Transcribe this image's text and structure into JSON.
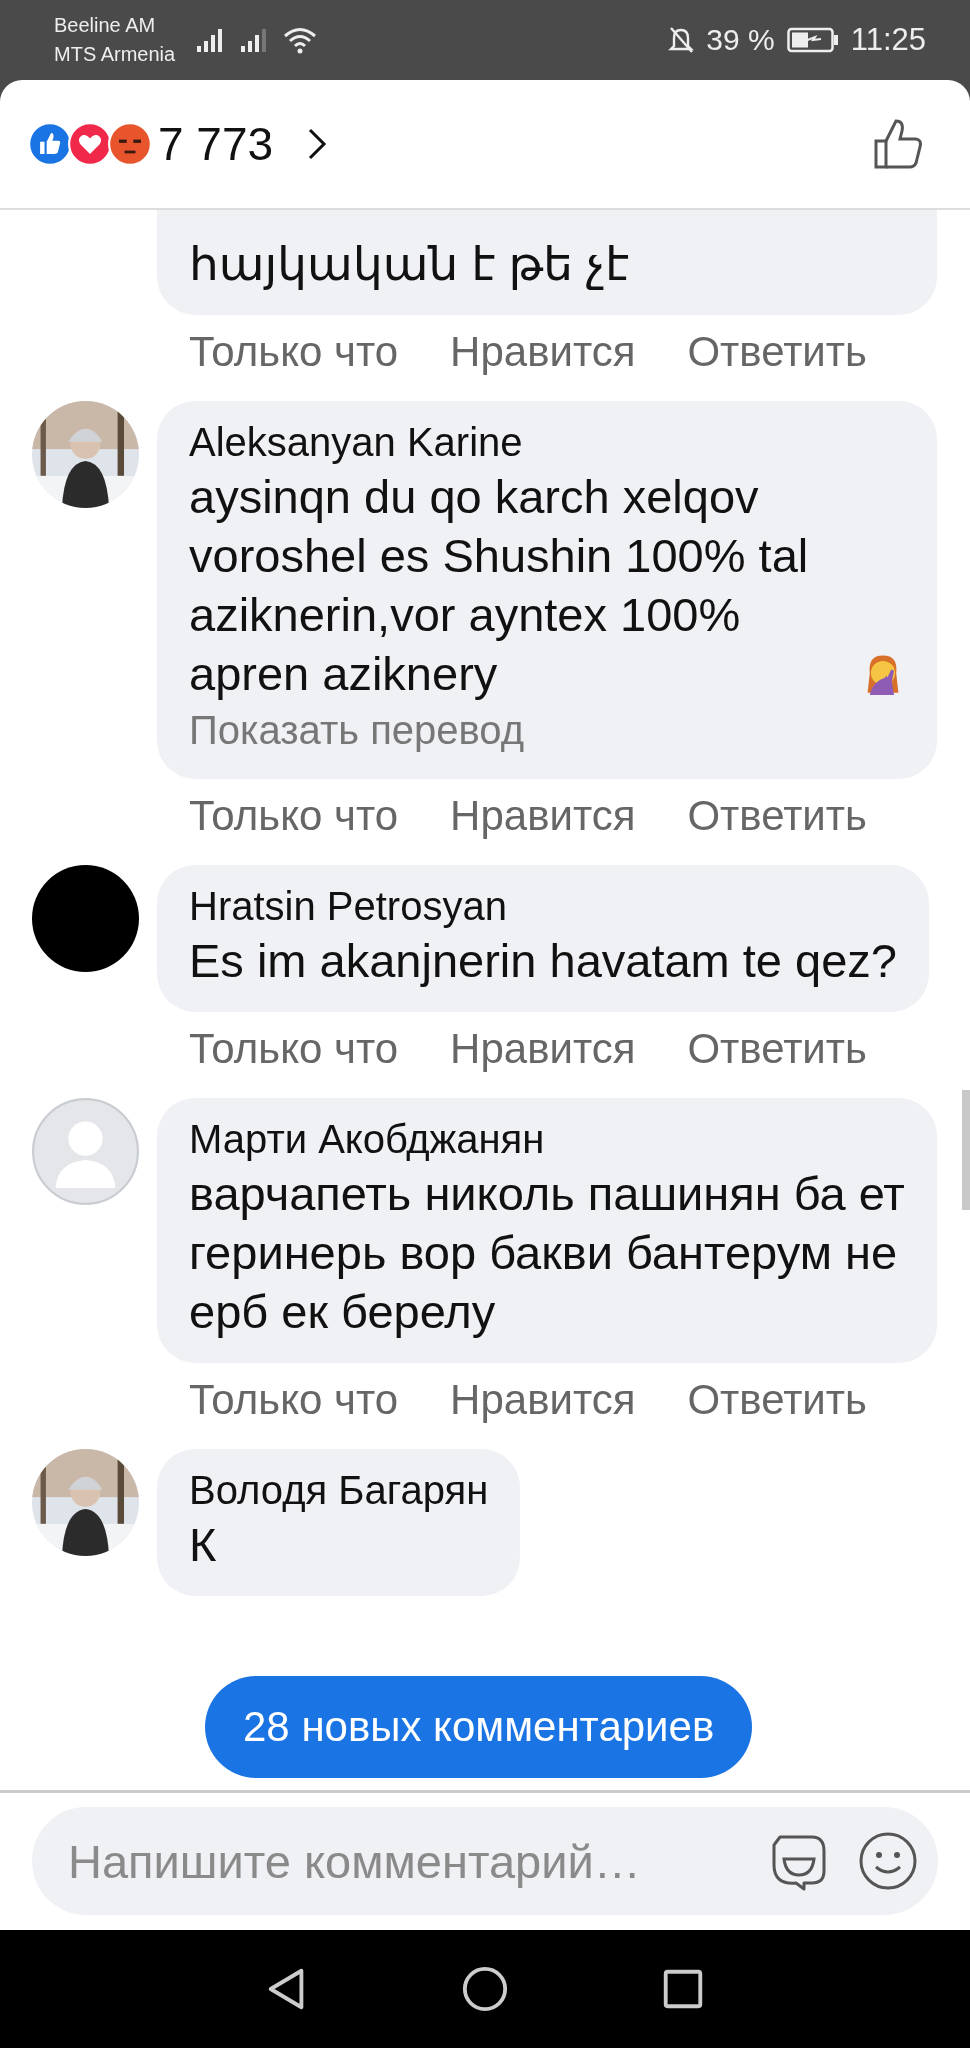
{
  "status_bar": {
    "carriers": [
      "Beeline AM",
      "MTS Armenia"
    ],
    "battery": "39 %",
    "time": "11:25"
  },
  "reactions": {
    "count": "7 773"
  },
  "comments": [
    {
      "avatar": {
        "kind": "none"
      },
      "text": "հայկական է թե չէ",
      "actions": [
        "Только что",
        "Нравится",
        "Ответить"
      ]
    },
    {
      "author": "Aleksanyan Karine",
      "text": "aysinqn du qo karch xelqov voroshel es Shushin 100% tal aziknerin,vor ayntex 100% apren aziknery",
      "trailing_emoji": true,
      "translate": "Показать перевод",
      "actions": [
        "Только что",
        "Нравится",
        "Ответить"
      ]
    },
    {
      "author": "Hratsin Petrosyan",
      "text": "Es im akanjnerin havatam te qez?",
      "actions": [
        "Только что",
        "Нравится",
        "Ответить"
      ]
    },
    {
      "avatar": {
        "kind": "default"
      },
      "author": "Марти Акобджанян",
      "text": "варчапеть николь пашинян ба ет геринерь вор бакви бантерум не ерб ек берелу",
      "actions": [
        "Только что",
        "Нравится",
        "Ответить"
      ]
    },
    {
      "author": "Володя Багарян",
      "text": "К"
    }
  ],
  "new_comments_button": "28 новых комментариев",
  "composer": {
    "placeholder": "Напишите комментарий…"
  }
}
